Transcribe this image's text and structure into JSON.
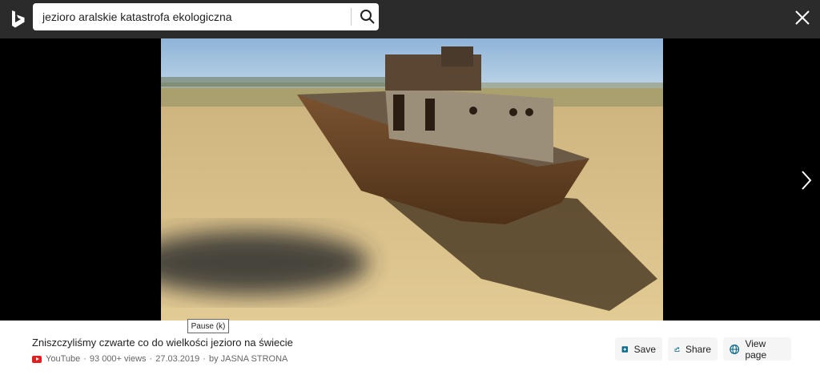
{
  "search": {
    "query": "jezioro aralskie katastrofa ekologiczna"
  },
  "icons": {
    "logo": "bing-logo-icon",
    "search": "search-icon",
    "close": "close-icon",
    "next": "chevron-right-icon",
    "youtube": "youtube-icon",
    "save": "save-icon",
    "share": "share-icon",
    "view_page": "globe-icon"
  },
  "tooltip": {
    "text": "Pause (k)"
  },
  "info": {
    "title": "Zniszczyliśmy czwarte co do wielkości jezioro na świecie",
    "source": "YouTube",
    "views": "93 000+ views",
    "date": "27.03.2019",
    "author": "by JASNA STRONA",
    "sep": "·"
  },
  "actions": {
    "save": "Save",
    "share": "Share",
    "view_page": "View page"
  },
  "colors": {
    "accent": "#0a6a8a",
    "topbar": "#2b2b2b",
    "youtube": "#e02020"
  }
}
